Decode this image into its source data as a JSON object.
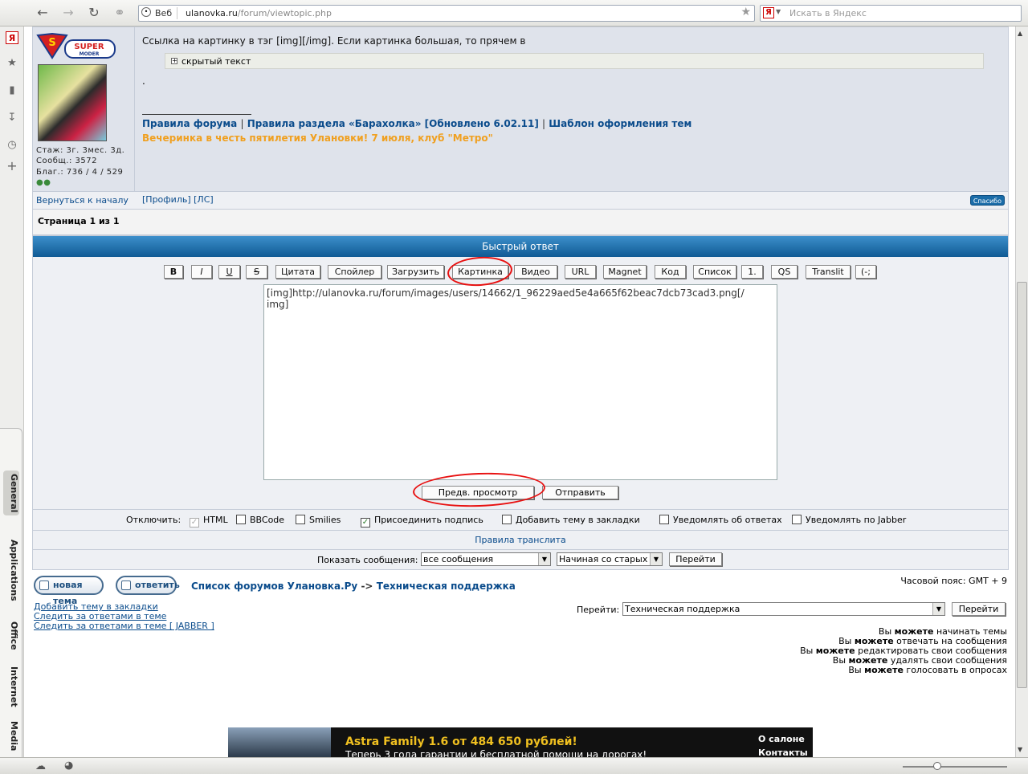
{
  "browser": {
    "web_label": "Веб",
    "url_host": "ulanovka.ru",
    "url_path": "/forum/viewtopic.php",
    "search_placeholder": "Искать в Яндекс",
    "search_engine_badge": "Я"
  },
  "sidebar_tabs": [
    "General",
    "Applications",
    "Office",
    "Internet",
    "Media"
  ],
  "post": {
    "rank_badge_top": "SUPER",
    "rank_badge_bottom": "MODER",
    "user_stats": [
      "Стаж: 3г. 3мес. 3д.",
      "Сообщ.: 3572",
      "Благ.: 736 / 4 / 529"
    ],
    "text": "Ссылка на картинку в тэг [img][/img]. Если картинка большая, то прячем в",
    "hidden_label": "скрытый текст",
    "dot": ".",
    "sig_links": [
      "Правила форума",
      "Правила раздела «Барахолка» [Обновлено 6.02.11]",
      "Шаблон оформления тем"
    ],
    "sig_sep": "|",
    "party_text": "Вечеринка в честь пятилетия Улановки! 7 июля, клуб \"Метро\"",
    "back_to_top": "Вернуться к началу",
    "profile_links": "[Профиль]  [ЛС]",
    "thanks_button": "Спасибо"
  },
  "pagination": "Страница 1 из 1",
  "quick_reply": {
    "header": "Быстрый ответ",
    "bbcode_buttons": [
      "B",
      "I",
      "U",
      "S",
      "Цитата",
      "Спойлер",
      "Загрузить",
      "Картинка",
      "Видео",
      "URL",
      "Magnet",
      "Код",
      "Список",
      "1.",
      "QS",
      "Translit",
      "(-;"
    ],
    "message": "[img]http://ulanovka.ru/forum/images/users/14662/1_96229aed5e4a665f62beac7dcb73cad3.png[/\nimg]",
    "preview_button": "Предв. просмотр",
    "submit_button": "Отправить",
    "disable_label": "Отключить:",
    "options": [
      {
        "label": "HTML",
        "checked": true,
        "disabled": true
      },
      {
        "label": "BBCode",
        "checked": false,
        "disabled": false
      },
      {
        "label": "Smilies",
        "checked": false,
        "disabled": false
      },
      {
        "label": "Присоединить подпись",
        "checked": true,
        "disabled": false
      },
      {
        "label": "Добавить тему в закладки",
        "checked": false,
        "disabled": false
      },
      {
        "label": "Уведомлять об ответах",
        "checked": false,
        "disabled": false
      },
      {
        "label": "Уведомлять по Jabber",
        "checked": false,
        "disabled": false
      }
    ],
    "translit_rules": "Правила транслита",
    "show_label": "Показать сообщения:",
    "show_value": "все сообщения",
    "order_value": "Начиная со старых",
    "go_button": "Перейти"
  },
  "footer": {
    "new_topic": "новая тема",
    "reply": "ответить",
    "breadcrumb_root": "Список форумов Улановка.Ру",
    "breadcrumb_sep": "->",
    "breadcrumb_current": "Техническая поддержка",
    "timezone": "Часовой пояс: GMT + 9",
    "topic_links": [
      "Добавить тему в закладки",
      "Следить за ответами в теме",
      "Следить за ответами в теме [ JABBER ]"
    ],
    "jump_label": "Перейти:",
    "jump_value": "Техническая поддержка",
    "jump_button": "Перейти",
    "permissions": [
      {
        "pre": "Вы",
        "bold": "можете",
        "post": "начинать темы"
      },
      {
        "pre": "Вы",
        "bold": "можете",
        "post": "отвечать на сообщения"
      },
      {
        "pre": "Вы",
        "bold": "можете",
        "post": "редактировать свои сообщения"
      },
      {
        "pre": "Вы",
        "bold": "можете",
        "post": "удалять свои сообщения"
      },
      {
        "pre": "Вы",
        "bold": "можете",
        "post": "голосовать в опросах"
      }
    ]
  },
  "ad": {
    "headline": "Astra Family 1.6 от 484 650 рублей!",
    "subline": "Теперь 3 года гарантии и бесплатной помощи на дорогах!",
    "link1": "О салоне",
    "link2": "Контакты"
  },
  "colors": {
    "accent": "#0b4c8c",
    "header_blue": "#1a6ca8",
    "annotation_red": "#e81010",
    "party_orange": "#f0a020"
  }
}
